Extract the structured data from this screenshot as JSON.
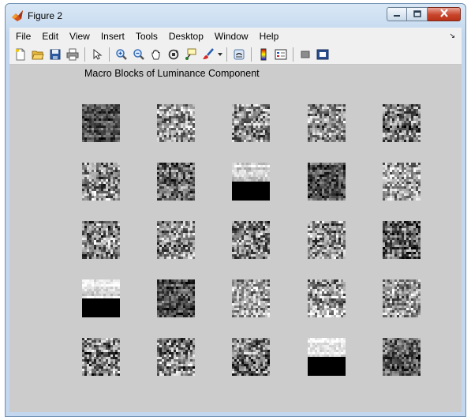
{
  "window": {
    "title": "Figure 2",
    "icon": "matlab-icon",
    "controls": [
      "minimize-icon",
      "maximize-icon",
      "close-icon"
    ]
  },
  "menu": {
    "items": [
      "File",
      "Edit",
      "View",
      "Insert",
      "Tools",
      "Desktop",
      "Window",
      "Help"
    ],
    "overflow_icon": "chevron-down-icon"
  },
  "toolbar": {
    "buttons": [
      "new-figure-icon",
      "open-file-icon",
      "save-icon",
      "print-icon",
      "edit-plot-icon",
      "zoom-in-icon",
      "zoom-out-icon",
      "pan-icon",
      "rotate-3d-icon",
      "data-cursor-icon",
      "brush-icon",
      "link-plot-icon",
      "colorbar-icon",
      "legend-icon",
      "hide-plot-tools-icon",
      "show-plot-tools-icon"
    ]
  },
  "figure": {
    "title": "Macro Blocks of Luminance Component",
    "background": "#cccccc",
    "grid": {
      "rows": 5,
      "cols": 5
    },
    "blocks": [
      {
        "row": 0,
        "col": 0,
        "mean": 0.28,
        "contrast": 0.22,
        "split": false
      },
      {
        "row": 0,
        "col": 1,
        "mean": 0.62,
        "contrast": 0.38,
        "split": false
      },
      {
        "row": 0,
        "col": 2,
        "mean": 0.52,
        "contrast": 0.4,
        "split": false
      },
      {
        "row": 0,
        "col": 3,
        "mean": 0.55,
        "contrast": 0.35,
        "split": false
      },
      {
        "row": 0,
        "col": 4,
        "mean": 0.48,
        "contrast": 0.38,
        "split": false
      },
      {
        "row": 1,
        "col": 0,
        "mean": 0.55,
        "contrast": 0.4,
        "split": false
      },
      {
        "row": 1,
        "col": 1,
        "mean": 0.42,
        "contrast": 0.35,
        "split": false
      },
      {
        "row": 1,
        "col": 2,
        "mean": 0.85,
        "contrast": 0.12,
        "split": true
      },
      {
        "row": 1,
        "col": 3,
        "mean": 0.32,
        "contrast": 0.25,
        "split": false
      },
      {
        "row": 1,
        "col": 4,
        "mean": 0.62,
        "contrast": 0.35,
        "split": false
      },
      {
        "row": 2,
        "col": 0,
        "mean": 0.5,
        "contrast": 0.4,
        "split": false
      },
      {
        "row": 2,
        "col": 1,
        "mean": 0.55,
        "contrast": 0.38,
        "split": false
      },
      {
        "row": 2,
        "col": 2,
        "mean": 0.5,
        "contrast": 0.42,
        "split": false
      },
      {
        "row": 2,
        "col": 3,
        "mean": 0.55,
        "contrast": 0.4,
        "split": false
      },
      {
        "row": 2,
        "col": 4,
        "mean": 0.4,
        "contrast": 0.38,
        "split": false
      },
      {
        "row": 3,
        "col": 0,
        "mean": 0.88,
        "contrast": 0.1,
        "split": true
      },
      {
        "row": 3,
        "col": 1,
        "mean": 0.3,
        "contrast": 0.25,
        "split": false
      },
      {
        "row": 3,
        "col": 2,
        "mean": 0.65,
        "contrast": 0.35,
        "split": false
      },
      {
        "row": 3,
        "col": 3,
        "mean": 0.62,
        "contrast": 0.38,
        "split": false
      },
      {
        "row": 3,
        "col": 4,
        "mean": 0.58,
        "contrast": 0.35,
        "split": false
      },
      {
        "row": 4,
        "col": 0,
        "mean": 0.5,
        "contrast": 0.42,
        "split": false
      },
      {
        "row": 4,
        "col": 1,
        "mean": 0.55,
        "contrast": 0.42,
        "split": false
      },
      {
        "row": 4,
        "col": 2,
        "mean": 0.48,
        "contrast": 0.4,
        "split": false
      },
      {
        "row": 4,
        "col": 3,
        "mean": 0.88,
        "contrast": 0.1,
        "split": true
      },
      {
        "row": 4,
        "col": 4,
        "mean": 0.35,
        "contrast": 0.3,
        "split": false
      }
    ]
  }
}
